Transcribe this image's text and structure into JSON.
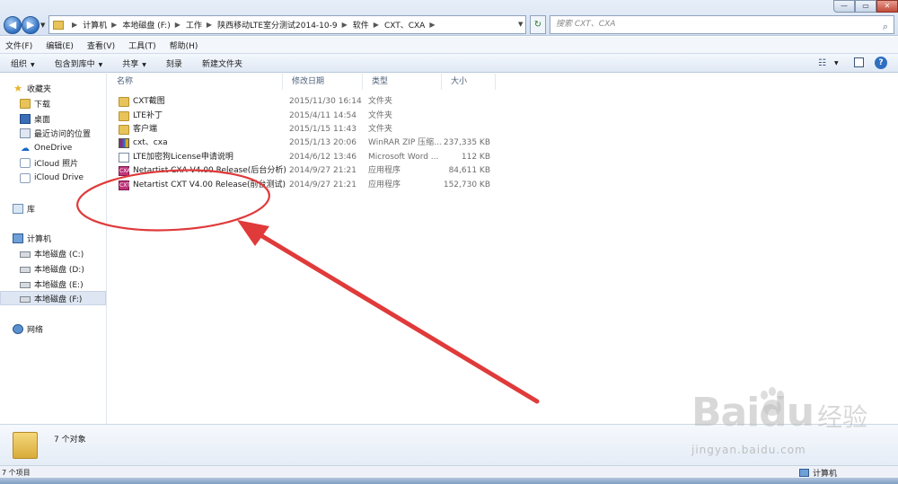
{
  "window": {
    "controls": [
      "—",
      "▭",
      "✕"
    ]
  },
  "address_bar": {
    "breadcrumbs": [
      "计算机",
      "本地磁盘 (F:)",
      "工作",
      "陕西移动LTE室分测试2014-10-9",
      "软件",
      "CXT、CXA"
    ],
    "search_placeholder": "搜索 CXT、CXA"
  },
  "menubar": {
    "items": [
      "文件(F)",
      "编辑(E)",
      "查看(V)",
      "工具(T)",
      "帮助(H)"
    ]
  },
  "commandbar": {
    "items": [
      {
        "label": "组织",
        "has_arrow": true
      },
      {
        "label": "包含到库中",
        "has_arrow": true
      },
      {
        "label": "共享",
        "has_arrow": true
      },
      {
        "label": "刻录",
        "has_arrow": false
      },
      {
        "label": "新建文件夹",
        "has_arrow": false
      }
    ]
  },
  "navpane": {
    "favorites": {
      "label": "收藏夹",
      "items": [
        "下载",
        "桌面",
        "最近访问的位置",
        "OneDrive",
        "iCloud 照片",
        "iCloud Drive"
      ]
    },
    "libraries": {
      "label": "库"
    },
    "computer": {
      "label": "计算机",
      "items": [
        "本地磁盘 (C:)",
        "本地磁盘 (D:)",
        "本地磁盘 (E:)",
        "本地磁盘 (F:)"
      ],
      "selected": "本地磁盘 (F:)"
    },
    "network": {
      "label": "网络"
    }
  },
  "filelist": {
    "columns": [
      "名称",
      "修改日期",
      "类型",
      "大小"
    ],
    "rows": [
      {
        "name": "CXT截图",
        "date": "2015/11/30 16:14",
        "type": "文件夹",
        "size": "",
        "icon": "folder-icon"
      },
      {
        "name": "LTE补丁",
        "date": "2015/4/11 14:54",
        "type": "文件夹",
        "size": "",
        "icon": "folder-icon"
      },
      {
        "name": "客户端",
        "date": "2015/1/15 11:43",
        "type": "文件夹",
        "size": "",
        "icon": "folder-icon"
      },
      {
        "name": "cxt、cxa",
        "date": "2015/1/13 20:06",
        "type": "WinRAR ZIP 压缩...",
        "size": "237,335 KB",
        "icon": "winrar-icon"
      },
      {
        "name": "LTE加密狗License申请说明",
        "date": "2014/6/12 13:46",
        "type": "Microsoft Word ...",
        "size": "112 KB",
        "icon": "word-document-icon"
      },
      {
        "name": "Netartist CXA V4.00 Release(后台分析)",
        "date": "2014/9/27 21:21",
        "type": "应用程序",
        "size": "84,611 KB",
        "icon": "cxa-app-icon"
      },
      {
        "name": "Netartist CXT V4.00 Release(前台测试)",
        "date": "2014/9/27 21:21",
        "type": "应用程序",
        "size": "152,730 KB",
        "icon": "cxt-app-icon"
      }
    ]
  },
  "details_pane": {
    "text": "7 个对象"
  },
  "statusbar": {
    "left": "7 个项目",
    "right": "计算机"
  },
  "watermark": {
    "logo": "Baidu",
    "cn": "经验",
    "url": "jingyan.baidu.com"
  },
  "annotation": {
    "color": "#e03a3a"
  }
}
